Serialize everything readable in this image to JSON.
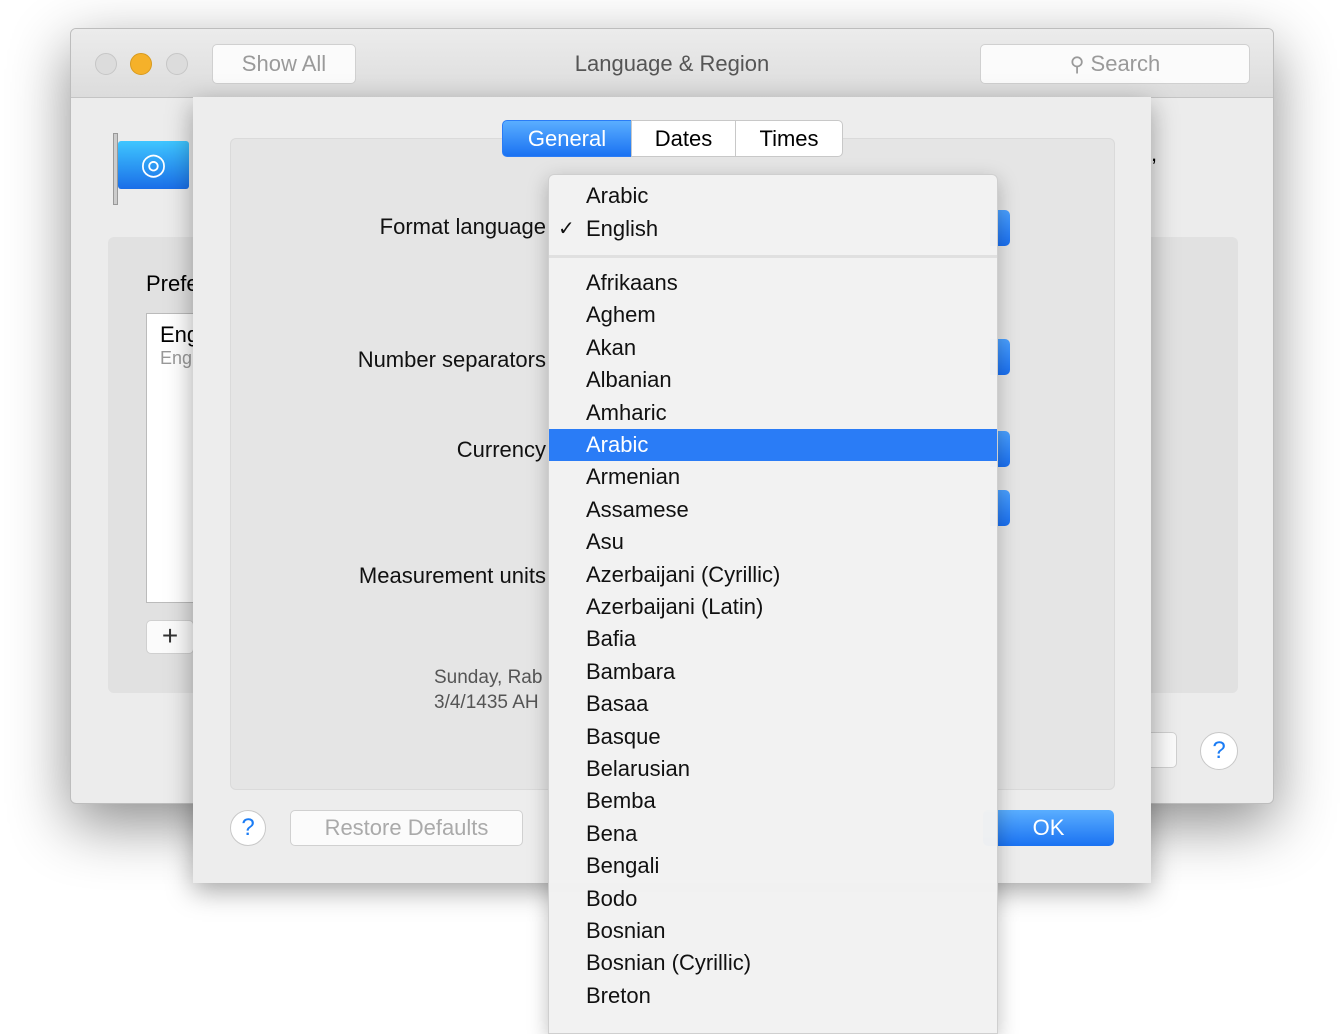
{
  "window": {
    "title": "Language & Region",
    "show_all": "Show All",
    "search_placeholder": "Search"
  },
  "background": {
    "preferred_label": "Prefe",
    "list_item_primary": "Eng",
    "list_item_secondary": "Eng",
    "add_button": "+",
    "help": "?",
    "partial_text": ","
  },
  "sheet": {
    "tabs": [
      {
        "label": "General",
        "active": true
      },
      {
        "label": "Dates",
        "active": false
      },
      {
        "label": "Times",
        "active": false
      }
    ],
    "labels": {
      "format_language": "Format language",
      "number_separators": "Number separators",
      "currency": "Currency",
      "measurement_units": "Measurement units"
    },
    "preview": {
      "line1": "Sunday, Rab",
      "line2": "3/4/1435 AH"
    },
    "help": "?",
    "restore_defaults": "Restore Defaults",
    "ok": "OK"
  },
  "menu": {
    "top_items": [
      {
        "label": "Arabic",
        "checked": false
      },
      {
        "label": "English",
        "checked": true
      }
    ],
    "check_glyph": "✓",
    "items": [
      "Afrikaans",
      "Aghem",
      "Akan",
      "Albanian",
      "Amharic",
      "Arabic",
      "Armenian",
      "Assamese",
      "Asu",
      "Azerbaijani (Cyrillic)",
      "Azerbaijani (Latin)",
      "Bafia",
      "Bambara",
      "Basaa",
      "Basque",
      "Belarusian",
      "Bemba",
      "Bena",
      "Bengali",
      "Bodo",
      "Bosnian",
      "Bosnian (Cyrillic)",
      "Breton"
    ],
    "highlighted": "Arabic"
  },
  "colors": {
    "accent": "#2a7cf6"
  }
}
